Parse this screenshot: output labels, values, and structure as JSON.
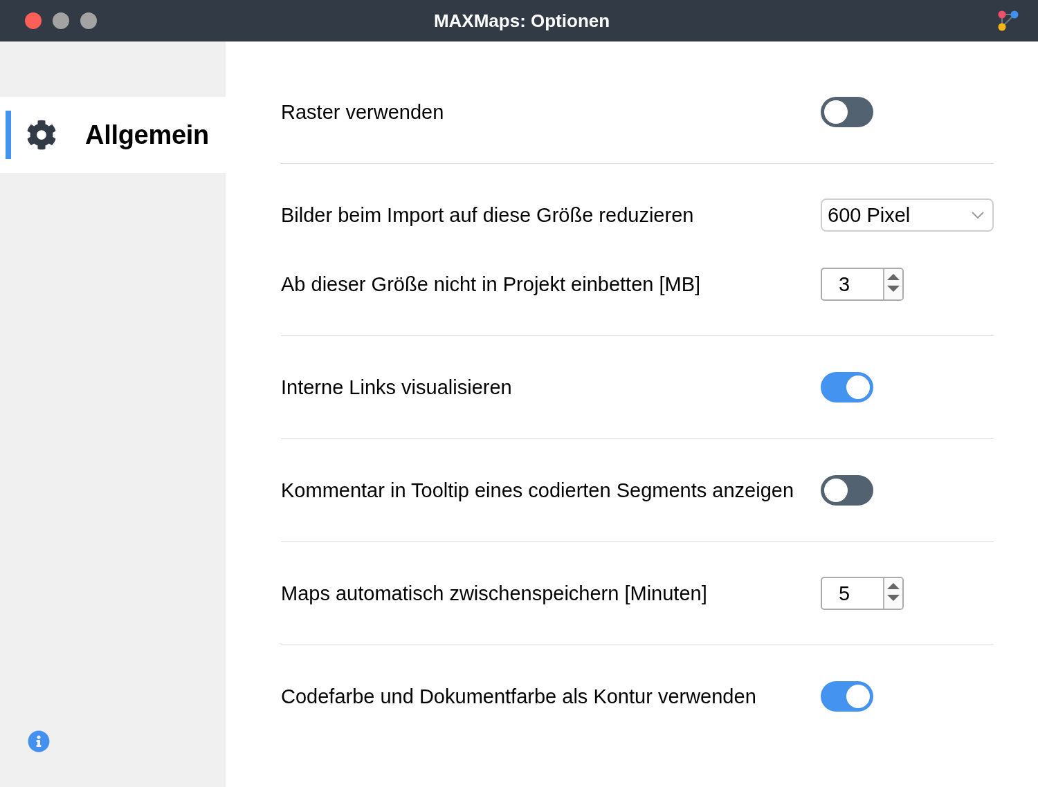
{
  "window": {
    "title": "MAXMaps: Optionen",
    "buttons": [
      {
        "kind": "close",
        "disabled": false
      },
      {
        "kind": "minimize",
        "disabled": true
      },
      {
        "kind": "zoom",
        "disabled": true
      }
    ]
  },
  "sidebar": {
    "items": [
      {
        "label": "Allgemein",
        "selected": true
      }
    ]
  },
  "settings": {
    "sections": [
      {
        "rows": [
          {
            "kind": "toggle",
            "label": "Raster verwenden",
            "on": false
          }
        ]
      },
      {
        "rows": [
          {
            "kind": "select",
            "label": "Bilder beim Import auf diese Größe reduzieren",
            "value": "600 Pixel"
          },
          {
            "kind": "number",
            "label": "Ab dieser Größe nicht in Projekt einbetten [MB]",
            "value": "3"
          }
        ]
      },
      {
        "rows": [
          {
            "kind": "toggle",
            "label": "Interne Links visualisieren",
            "on": true
          }
        ]
      },
      {
        "rows": [
          {
            "kind": "toggle",
            "label": "Kommentar in Tooltip eines codierten Segments anzeigen",
            "on": false
          }
        ]
      },
      {
        "rows": [
          {
            "kind": "number",
            "label": "Maps automatisch zwischenspeichern [Minuten]",
            "value": "5"
          }
        ]
      },
      {
        "rows": [
          {
            "kind": "toggle",
            "label": "Codefarbe und Dokumentfarbe als Kontur verwenden",
            "on": true
          }
        ]
      }
    ]
  }
}
